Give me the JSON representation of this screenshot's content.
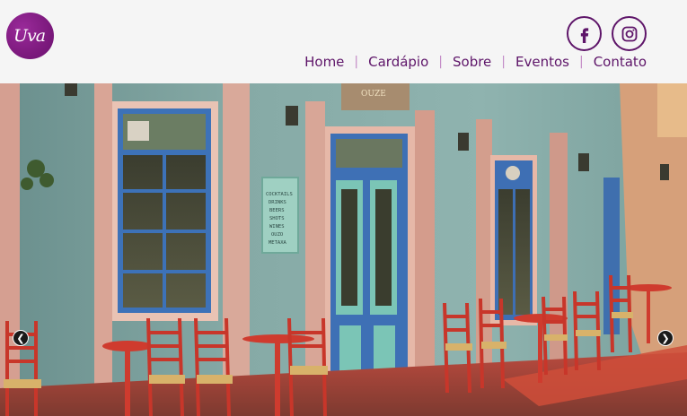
{
  "brand": {
    "logo_text": "Uva",
    "accent_color": "#5e1569"
  },
  "social": [
    {
      "name": "facebook-icon"
    },
    {
      "name": "instagram-icon"
    }
  ],
  "nav": {
    "items": [
      {
        "label": "Home"
      },
      {
        "label": "Cardápio"
      },
      {
        "label": "Sobre"
      },
      {
        "label": "Eventos"
      },
      {
        "label": "Contato"
      }
    ]
  },
  "hero": {
    "image_description": "",
    "sign_lines": [
      "COCKTAILS",
      "DRINKS",
      "BEERS",
      "SHOTS",
      "WINES",
      "OUZO",
      "METAXA"
    ],
    "top_sign": "OUZE",
    "prev_icon": "chevron-left-icon",
    "next_icon": "chevron-right-icon"
  }
}
